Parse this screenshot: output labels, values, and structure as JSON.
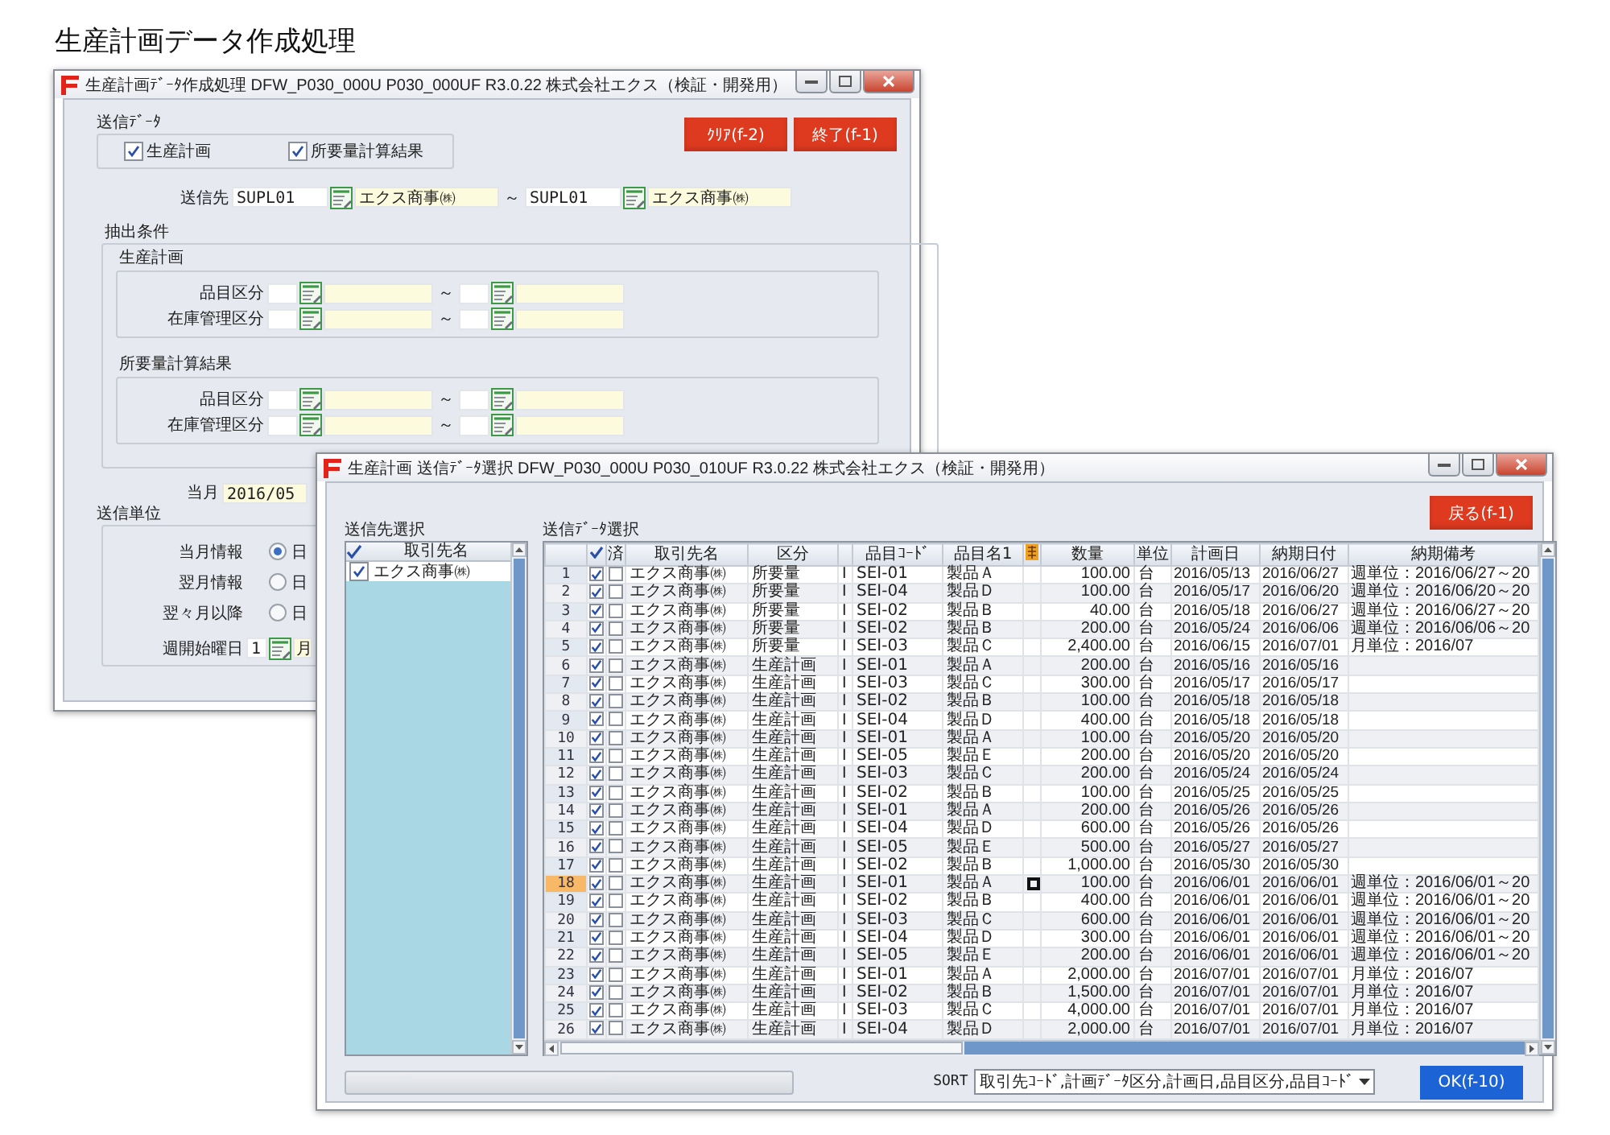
{
  "page_title": "生産計画データ作成処理",
  "main_window": {
    "title": "生産計画ﾃﾞｰﾀ作成処理 DFW_P030_000U P030_000UF R3.0.22 株式会社エクス（検証・開発用）",
    "send_data": {
      "label": "送信ﾃﾞｰﾀ",
      "options": [
        {
          "label": "生産計画",
          "checked": true
        },
        {
          "label": "所要量計算結果",
          "checked": true
        }
      ]
    },
    "buttons": [
      {
        "label": "ｸﾘｱ(f-2)"
      },
      {
        "label": "終了(f-1)"
      }
    ],
    "destination": {
      "label": "送信先",
      "from": {
        "code": "SUPL01",
        "name": "エクス商事㈱"
      },
      "separator": "～",
      "to": {
        "code": "SUPL01",
        "name": "エクス商事㈱"
      }
    },
    "extraction": {
      "label": "抽出条件",
      "sections": [
        {
          "label": "生産計画",
          "rows": [
            {
              "label": "品目区分",
              "separator": "～"
            },
            {
              "label": "在庫管理区分",
              "separator": "～"
            }
          ]
        },
        {
          "label": "所要量計算結果",
          "rows": [
            {
              "label": "品目区分",
              "separator": "～"
            },
            {
              "label": "在庫管理区分",
              "separator": "～"
            }
          ]
        }
      ]
    },
    "current_month": {
      "label": "当月",
      "value": "2016/05"
    },
    "send_unit": {
      "label": "送信単位",
      "rows": [
        {
          "label": "当月情報",
          "option": "日",
          "selected": true
        },
        {
          "label": "翌月情報",
          "option": "日",
          "selected": false
        },
        {
          "label": "翌々月以降",
          "option": "日",
          "selected": false
        }
      ],
      "week_start": {
        "label": "週開始曜日",
        "value": "1",
        "name": "月"
      }
    }
  },
  "select_window": {
    "title": "生産計画 送信ﾃﾞｰﾀ選択 DFW_P030_000U P030_010UF R3.0.22 株式会社エクス（検証・開発用）",
    "back_button": "戻る(f-1)",
    "destination_panel": {
      "label": "送信先選択",
      "column": "取引先名",
      "items": [
        {
          "label": "エクス商事㈱",
          "checked": true
        }
      ]
    },
    "data_panel": {
      "label": "送信ﾃﾞｰﾀ選択",
      "done_label": "済",
      "columns": [
        {
          "kind": "text",
          "label": "取引先名"
        },
        {
          "kind": "text",
          "label": "区分"
        },
        {
          "kind": "blank"
        },
        {
          "kind": "text",
          "label": "品目ｺｰﾄﾞ"
        },
        {
          "kind": "text",
          "label": "品目名1"
        },
        {
          "kind": "number",
          "label": "数量"
        },
        {
          "kind": "text",
          "label": "単位"
        },
        {
          "kind": "date",
          "label": "計画日"
        },
        {
          "kind": "date",
          "label": "納期日付"
        },
        {
          "kind": "text",
          "label": "納期備考"
        }
      ],
      "rows": [
        {
          "no": "1",
          "selected": false,
          "checked": true,
          "done": false,
          "cells": [
            "エクス商事㈱",
            "所要量",
            "I",
            "SEI-01",
            "製品Ａ",
            "100.00",
            "台",
            "2016/05/13",
            "2016/06/27",
            "週単位：2016/06/27～20"
          ]
        },
        {
          "no": "2",
          "selected": false,
          "checked": true,
          "done": false,
          "cells": [
            "エクス商事㈱",
            "所要量",
            "I",
            "SEI-04",
            "製品Ｄ",
            "100.00",
            "台",
            "2016/05/17",
            "2016/06/20",
            "週単位：2016/06/20～20"
          ]
        },
        {
          "no": "3",
          "selected": false,
          "checked": true,
          "done": false,
          "cells": [
            "エクス商事㈱",
            "所要量",
            "I",
            "SEI-02",
            "製品Ｂ",
            "40.00",
            "台",
            "2016/05/18",
            "2016/06/27",
            "週単位：2016/06/27～20"
          ]
        },
        {
          "no": "4",
          "selected": false,
          "checked": true,
          "done": false,
          "cells": [
            "エクス商事㈱",
            "所要量",
            "I",
            "SEI-02",
            "製品Ｂ",
            "200.00",
            "台",
            "2016/05/24",
            "2016/06/06",
            "週単位：2016/06/06～20"
          ]
        },
        {
          "no": "5",
          "selected": false,
          "checked": true,
          "done": false,
          "cells": [
            "エクス商事㈱",
            "所要量",
            "I",
            "SEI-03",
            "製品Ｃ",
            "2,400.00",
            "台",
            "2016/06/15",
            "2016/07/01",
            "月単位：2016/07"
          ]
        },
        {
          "no": "6",
          "selected": false,
          "checked": true,
          "done": false,
          "cells": [
            "エクス商事㈱",
            "生産計画",
            "I",
            "SEI-01",
            "製品Ａ",
            "200.00",
            "台",
            "2016/05/16",
            "2016/05/16"
          ]
        },
        {
          "no": "7",
          "selected": false,
          "checked": true,
          "done": false,
          "cells": [
            "エクス商事㈱",
            "生産計画",
            "I",
            "SEI-03",
            "製品Ｃ",
            "300.00",
            "台",
            "2016/05/17",
            "2016/05/17"
          ]
        },
        {
          "no": "8",
          "selected": false,
          "checked": true,
          "done": false,
          "cells": [
            "エクス商事㈱",
            "生産計画",
            "I",
            "SEI-02",
            "製品Ｂ",
            "100.00",
            "台",
            "2016/05/18",
            "2016/05/18"
          ]
        },
        {
          "no": "9",
          "selected": false,
          "checked": true,
          "done": false,
          "cells": [
            "エクス商事㈱",
            "生産計画",
            "I",
            "SEI-04",
            "製品Ｄ",
            "400.00",
            "台",
            "2016/05/18",
            "2016/05/18"
          ]
        },
        {
          "no": "10",
          "selected": false,
          "checked": true,
          "done": false,
          "cells": [
            "エクス商事㈱",
            "生産計画",
            "I",
            "SEI-01",
            "製品Ａ",
            "100.00",
            "台",
            "2016/05/20",
            "2016/05/20"
          ]
        },
        {
          "no": "11",
          "selected": false,
          "checked": true,
          "done": false,
          "cells": [
            "エクス商事㈱",
            "生産計画",
            "I",
            "SEI-05",
            "製品Ｅ",
            "200.00",
            "台",
            "2016/05/20",
            "2016/05/20"
          ]
        },
        {
          "no": "12",
          "selected": false,
          "checked": true,
          "done": false,
          "cells": [
            "エクス商事㈱",
            "生産計画",
            "I",
            "SEI-03",
            "製品Ｃ",
            "200.00",
            "台",
            "2016/05/24",
            "2016/05/24"
          ]
        },
        {
          "no": "13",
          "selected": false,
          "checked": true,
          "done": false,
          "cells": [
            "エクス商事㈱",
            "生産計画",
            "I",
            "SEI-02",
            "製品Ｂ",
            "100.00",
            "台",
            "2016/05/25",
            "2016/05/25"
          ]
        },
        {
          "no": "14",
          "selected": false,
          "checked": true,
          "done": false,
          "cells": [
            "エクス商事㈱",
            "生産計画",
            "I",
            "SEI-01",
            "製品Ａ",
            "200.00",
            "台",
            "2016/05/26",
            "2016/05/26"
          ]
        },
        {
          "no": "15",
          "selected": false,
          "checked": true,
          "done": false,
          "cells": [
            "エクス商事㈱",
            "生産計画",
            "I",
            "SEI-04",
            "製品Ｄ",
            "600.00",
            "台",
            "2016/05/26",
            "2016/05/26"
          ]
        },
        {
          "no": "16",
          "selected": false,
          "checked": true,
          "done": false,
          "cells": [
            "エクス商事㈱",
            "生産計画",
            "I",
            "SEI-05",
            "製品Ｅ",
            "500.00",
            "台",
            "2016/05/27",
            "2016/05/27"
          ]
        },
        {
          "no": "17",
          "selected": false,
          "checked": true,
          "done": false,
          "cells": [
            "エクス商事㈱",
            "生産計画",
            "I",
            "SEI-02",
            "製品Ｂ",
            "1,000.00",
            "台",
            "2016/05/30",
            "2016/05/30"
          ]
        },
        {
          "no": "18",
          "selected": true,
          "checked": true,
          "done": false,
          "cells": [
            "エクス商事㈱",
            "生産計画",
            "I",
            "SEI-01",
            "製品Ａ",
            "100.00",
            "台",
            "2016/06/01",
            "2016/06/01",
            "週単位：2016/06/01～20"
          ]
        },
        {
          "no": "19",
          "selected": false,
          "checked": true,
          "done": false,
          "cells": [
            "エクス商事㈱",
            "生産計画",
            "I",
            "SEI-02",
            "製品Ｂ",
            "400.00",
            "台",
            "2016/06/01",
            "2016/06/01",
            "週単位：2016/06/01～20"
          ]
        },
        {
          "no": "20",
          "selected": false,
          "checked": true,
          "done": false,
          "cells": [
            "エクス商事㈱",
            "生産計画",
            "I",
            "SEI-03",
            "製品Ｃ",
            "600.00",
            "台",
            "2016/06/01",
            "2016/06/01",
            "週単位：2016/06/01～20"
          ]
        },
        {
          "no": "21",
          "selected": false,
          "checked": true,
          "done": false,
          "cells": [
            "エクス商事㈱",
            "生産計画",
            "I",
            "SEI-04",
            "製品Ｄ",
            "300.00",
            "台",
            "2016/06/01",
            "2016/06/01",
            "週単位：2016/06/01～20"
          ]
        },
        {
          "no": "22",
          "selected": false,
          "checked": true,
          "done": false,
          "cells": [
            "エクス商事㈱",
            "生産計画",
            "I",
            "SEI-05",
            "製品Ｅ",
            "200.00",
            "台",
            "2016/06/01",
            "2016/06/01",
            "週単位：2016/06/01～20"
          ]
        },
        {
          "no": "23",
          "selected": false,
          "checked": true,
          "done": false,
          "cells": [
            "エクス商事㈱",
            "生産計画",
            "I",
            "SEI-01",
            "製品Ａ",
            "2,000.00",
            "台",
            "2016/07/01",
            "2016/07/01",
            "月単位：2016/07"
          ]
        },
        {
          "no": "24",
          "selected": false,
          "checked": true,
          "done": false,
          "cells": [
            "エクス商事㈱",
            "生産計画",
            "I",
            "SEI-02",
            "製品Ｂ",
            "1,500.00",
            "台",
            "2016/07/01",
            "2016/07/01",
            "月単位：2016/07"
          ]
        },
        {
          "no": "25",
          "selected": false,
          "checked": true,
          "done": false,
          "cells": [
            "エクス商事㈱",
            "生産計画",
            "I",
            "SEI-03",
            "製品Ｃ",
            "4,000.00",
            "台",
            "2016/07/01",
            "2016/07/01",
            "月単位：2016/07"
          ]
        },
        {
          "no": "26",
          "selected": false,
          "checked": true,
          "done": false,
          "cells": [
            "エクス商事㈱",
            "生産計画",
            "I",
            "SEI-04",
            "製品Ｄ",
            "2,000.00",
            "台",
            "2016/07/01",
            "2016/07/01",
            "月単位：2016/07"
          ]
        }
      ]
    },
    "progress": {
      "level": 0
    },
    "sort": {
      "label": "SORT",
      "value": "取引先ｺｰﾄﾞ,計画ﾃﾞｰﾀ区分,計画日,品目区分,品目ｺｰﾄﾞ"
    },
    "ok_button": "OK(f-10)"
  }
}
